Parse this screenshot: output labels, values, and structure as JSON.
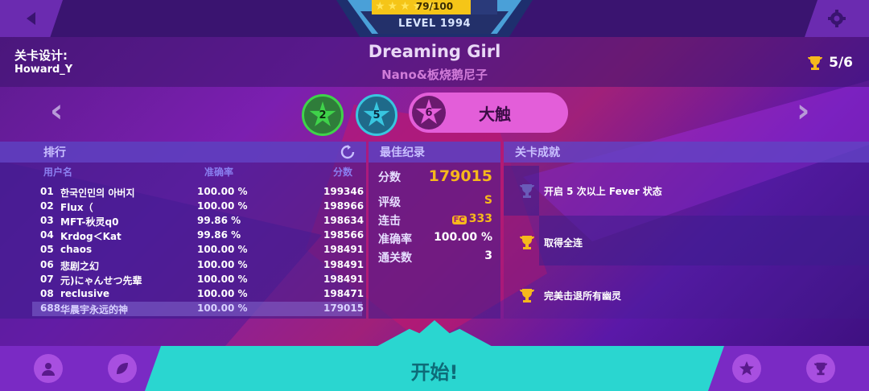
{
  "top": {
    "progress_text": "79/100",
    "progress_fraction": 0.79,
    "level_text": "LEVEL 1994"
  },
  "header": {
    "designer_label": "关卡设计:",
    "designer_name": "Howard_Y",
    "song_title": "Dreaming Girl",
    "song_artist": "Nano&板烧鹅尼子",
    "trophy_count": "5/6"
  },
  "difficulties": [
    {
      "level": "2",
      "color": "#3fd34a"
    },
    {
      "level": "5",
      "color": "#38c6e0"
    },
    {
      "level": "6",
      "label": "大触",
      "color": "#e35ed9"
    }
  ],
  "ranking": {
    "title": "排行",
    "col_user": "用户名",
    "col_acc": "准确率",
    "col_score": "分数",
    "rows": [
      {
        "rank": "01",
        "name": "한국인민의 아버지",
        "acc": "100.00 %",
        "score": "199346"
      },
      {
        "rank": "02",
        "name": "Flux（",
        "acc": "100.00 %",
        "score": "198966"
      },
      {
        "rank": "03",
        "name": "MFT-秋灵q0",
        "acc": "99.86 %",
        "score": "198634"
      },
      {
        "rank": "04",
        "name": "Krdog＜Kat",
        "acc": "99.86 %",
        "score": "198566"
      },
      {
        "rank": "05",
        "name": "chaos",
        "acc": "100.00 %",
        "score": "198491"
      },
      {
        "rank": "06",
        "name": "悲剧之幻",
        "acc": "100.00 %",
        "score": "198491"
      },
      {
        "rank": "07",
        "name": "元)にゃんせつ先辈",
        "acc": "100.00 %",
        "score": "198491"
      },
      {
        "rank": "08",
        "name": "reclusive",
        "acc": "100.00 %",
        "score": "198471"
      },
      {
        "rank": "688",
        "name": "华晨宇永远的神",
        "acc": "100.00 %",
        "score": "179015"
      }
    ]
  },
  "best": {
    "title": "最佳纪录",
    "score_label": "分数",
    "score": "179015",
    "grade_label": "评级",
    "grade": "S",
    "combo_label": "连击",
    "combo_badge": "FC",
    "combo": "333",
    "acc_label": "准确率",
    "acc": "100.00 %",
    "clears_label": "通关数",
    "clears": "3"
  },
  "achievements": {
    "title": "关卡成就",
    "items": [
      {
        "text": "开启 5 次以上 Fever 状态",
        "achieved": false
      },
      {
        "text": "取得全连",
        "achieved": true
      },
      {
        "text": "完美击退所有幽灵",
        "achieved": true
      }
    ]
  },
  "start_label": "开始!",
  "colors": {
    "accent_gold": "#f6b81c",
    "start_cyan": "#2ad6d0",
    "selected_pink": "#e35ed9"
  }
}
